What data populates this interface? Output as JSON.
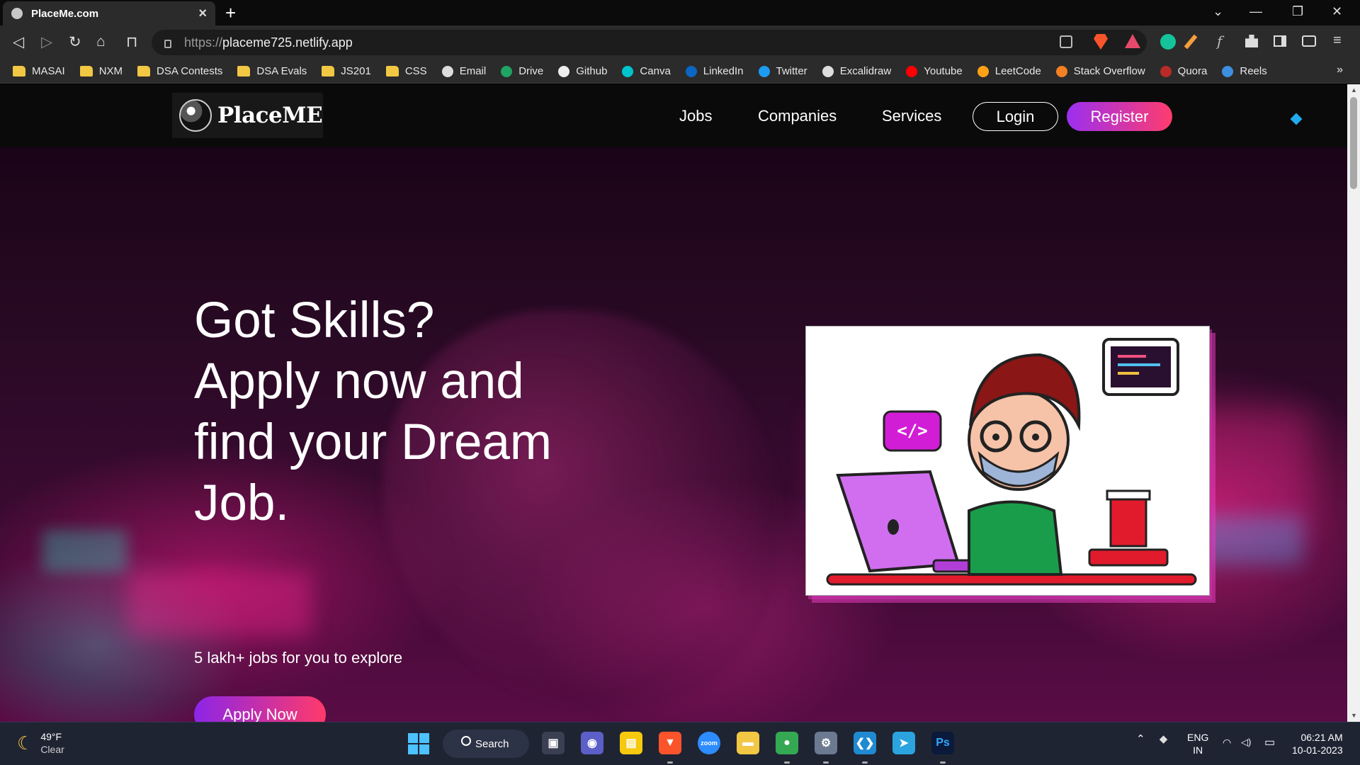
{
  "browser": {
    "tab": {
      "title": "PlaceMe.com",
      "close": "×"
    },
    "new_tab": "+",
    "window_controls": {
      "dropdown": "⌄",
      "minimize": "—",
      "restore": "❐",
      "close": "✕"
    },
    "nav": {
      "back": "◁",
      "forward": "▷",
      "reload": "↻",
      "home": "⌂",
      "bookmark": "⊓"
    },
    "url": {
      "protocol": "https://",
      "host": "placeme725.netlify.app"
    },
    "bookmarks": [
      {
        "label": "MASAI",
        "icon": "folder-icon"
      },
      {
        "label": "NXM",
        "icon": "folder-icon"
      },
      {
        "label": "DSA Contests",
        "icon": "folder-icon"
      },
      {
        "label": "DSA Evals",
        "icon": "folder-icon"
      },
      {
        "label": "JS201",
        "icon": "folder-icon"
      },
      {
        "label": "CSS",
        "icon": "folder-icon"
      },
      {
        "label": "Email",
        "icon": "globe-icon"
      },
      {
        "label": "Drive",
        "icon": "drive-icon"
      },
      {
        "label": "Github",
        "icon": "github-icon"
      },
      {
        "label": "Canva",
        "icon": "canva-icon"
      },
      {
        "label": "LinkedIn",
        "icon": "linkedin-icon"
      },
      {
        "label": "Twitter",
        "icon": "twitter-icon"
      },
      {
        "label": "Excalidraw",
        "icon": "globe-icon"
      },
      {
        "label": "Youtube",
        "icon": "youtube-icon"
      },
      {
        "label": "LeetCode",
        "icon": "leetcode-icon"
      },
      {
        "label": "Stack Overflow",
        "icon": "stackoverflow-icon"
      },
      {
        "label": "Quora",
        "icon": "quora-icon"
      },
      {
        "label": "Reels",
        "icon": "download-icon"
      }
    ],
    "bookmarks_more": "»"
  },
  "site": {
    "logo_text": "PlaceME",
    "nav": {
      "jobs": "Jobs",
      "companies": "Companies",
      "services": "Services",
      "login": "Login",
      "register": "Register"
    },
    "hero": {
      "heading": "Got Skills? Apply now and find your Dream Job.",
      "subheading": "5 lakh+ jobs for you to explore",
      "cta": "Apply Now"
    },
    "illustration": {
      "code_tag": "</>"
    }
  },
  "taskbar": {
    "weather": {
      "temp": "49°F",
      "condition": "Clear"
    },
    "search_label": "Search",
    "apps": [
      {
        "name": "task-view",
        "glyph": "▣",
        "color": "#3a3f52"
      },
      {
        "name": "chat",
        "glyph": "◉",
        "color": "#5b5fc7"
      },
      {
        "name": "sticky-notes",
        "glyph": "▤",
        "color": "#f6c90e"
      },
      {
        "name": "brave",
        "glyph": "▼",
        "color": "#fb542b"
      },
      {
        "name": "zoom",
        "glyph": "zoom",
        "color": "#2d8cff"
      },
      {
        "name": "file-explorer",
        "glyph": "▬",
        "color": "#f2c744"
      },
      {
        "name": "chrome",
        "glyph": "●",
        "color": "#34a853"
      },
      {
        "name": "settings",
        "glyph": "⚙",
        "color": "#6b7a90"
      },
      {
        "name": "vscode",
        "glyph": "❮❯",
        "color": "#1f8ad2"
      },
      {
        "name": "telegram",
        "glyph": "➤",
        "color": "#2aa3df"
      },
      {
        "name": "photoshop",
        "glyph": "Ps",
        "color": "#0b1a3a"
      }
    ],
    "tray": {
      "chevron": "⌃",
      "dropbox": "◆",
      "wifi": "◠",
      "volume": "◁)",
      "battery": "▭"
    },
    "language": {
      "lang": "ENG",
      "region": "IN"
    },
    "clock": {
      "time": "06:21 AM",
      "date": "10-01-2023"
    }
  },
  "colors": {
    "accent_purple": "#9b2ff0",
    "accent_pink": "#ff3c6e",
    "diamond": "#22aaf0"
  }
}
